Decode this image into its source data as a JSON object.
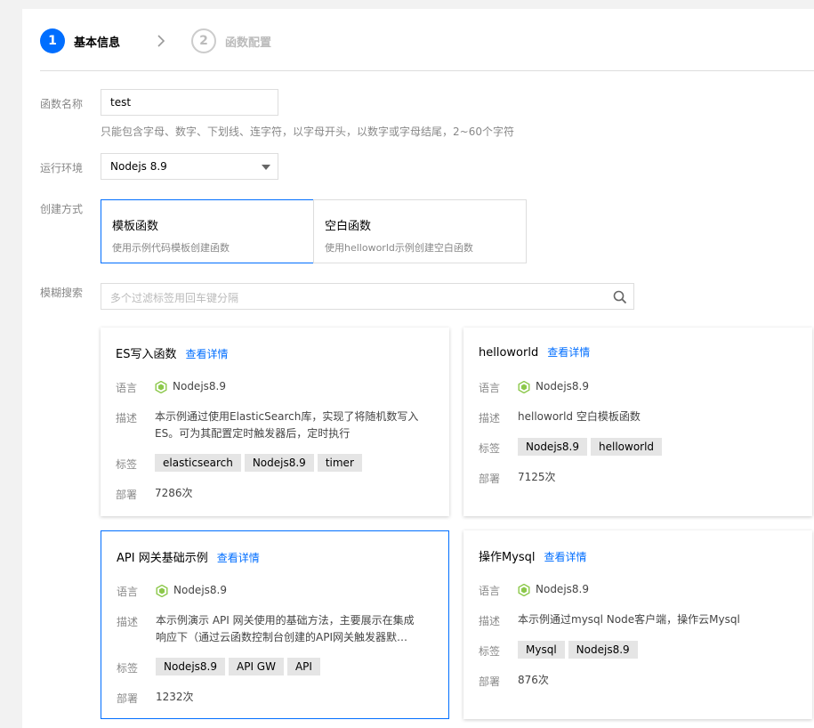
{
  "steps": [
    {
      "num": "1",
      "label": "基本信息"
    },
    {
      "num": "2",
      "label": "函数配置"
    }
  ],
  "form": {
    "name_label": "函数名称",
    "name_value": "test",
    "name_hint": "只能包含字母、数字、下划线、连字符，以字母开头，以数字或字母结尾，2~60个字符",
    "runtime_label": "运行环境",
    "runtime_value": "Nodejs 8.9",
    "create_label": "创建方式",
    "modes": [
      {
        "title": "模板函数",
        "desc": "使用示例代码模板创建函数"
      },
      {
        "title": "空白函数",
        "desc": "使用helloworld示例创建空白函数"
      }
    ],
    "search_label": "模糊搜索",
    "search_placeholder": "多个过滤标签用回车键分隔"
  },
  "colors": {
    "accent": "#006eff",
    "node_green": "#8cc84b"
  },
  "row_labels": {
    "lang": "语言",
    "desc": "描述",
    "tags": "标签",
    "deploy": "部署"
  },
  "cards": [
    {
      "title": "ES写入函数",
      "link": "查看详情",
      "lang": "Nodejs8.9",
      "desc": "本示例通过使用ElasticSearch库，实现了将随机数写入ES。可为其配置定时触发器后，定时执行",
      "tags": [
        "elasticsearch",
        "Nodejs8.9",
        "timer"
      ],
      "deploy": "7286次"
    },
    {
      "title": "helloworld",
      "link": "查看详情",
      "lang": "Nodejs8.9",
      "desc": "helloworld 空白模板函数",
      "tags": [
        "Nodejs8.9",
        "helloworld"
      ],
      "deploy": "7125次"
    },
    {
      "title": "API 网关基础示例",
      "link": "查看详情",
      "lang": "Nodejs8.9",
      "desc": "本示例演示 API 网关使用的基础方法，主要展示在集成响应下（通过云函数控制台创建的API网关触发器默…",
      "tags": [
        "Nodejs8.9",
        "API GW",
        "API"
      ],
      "deploy": "1232次"
    },
    {
      "title": "操作Mysql",
      "link": "查看详情",
      "lang": "Nodejs8.9",
      "desc": "本示例通过mysql Node客户端，操作云Mysql",
      "tags": [
        "Mysql",
        "Nodejs8.9"
      ],
      "deploy": "876次"
    }
  ]
}
